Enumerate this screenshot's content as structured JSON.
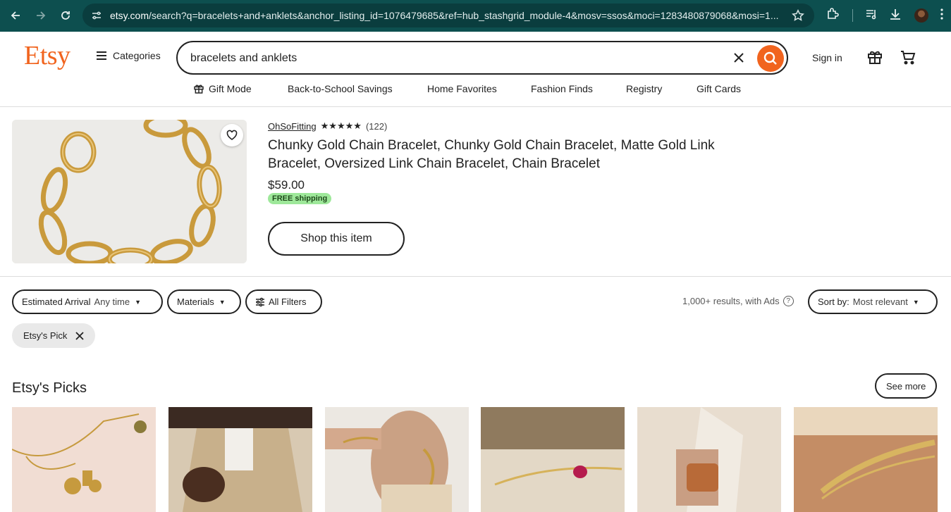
{
  "browser": {
    "url_host": "etsy.com",
    "url_rest": "/search?q=bracelets+and+anklets&anchor_listing_id=1076479685&ref=hub_stashgrid_module-4&mosv=ssos&moci=1283480879068&mosi=1..."
  },
  "header": {
    "logo": "Etsy",
    "categories_label": "Categories",
    "search_value": "bracelets and anklets",
    "signin_label": "Sign in",
    "subnav": [
      "Gift Mode",
      "Back-to-School Savings",
      "Home Favorites",
      "Fashion Finds",
      "Registry",
      "Gift Cards"
    ]
  },
  "ad": {
    "shop_name": "OhSoFitting",
    "stars": "★★★★★",
    "review_count": "(122)",
    "title": "Chunky Gold Chain Bracelet, Chunky Gold Chain Bracelet, Matte Gold Link Bracelet, Oversized Link Chain Bracelet, Chain Bracelet",
    "price": "$59.00",
    "shipping_badge": "FREE shipping",
    "cta": "Shop this item"
  },
  "filters": {
    "arrival_label": "Estimated Arrival",
    "arrival_value": "Any time",
    "materials_label": "Materials",
    "all_filters_label": "All Filters",
    "results_text": "1,000+ results, with Ads",
    "sort_label": "Sort by:",
    "sort_value": "Most relevant",
    "active_chip": "Etsy's Pick"
  },
  "picks": {
    "title": "Etsy's Picks",
    "see_more": "See more"
  },
  "colors": {
    "brand": "#f1641e",
    "chrome": "#0d4f4f",
    "free_shipping": "#9ee89a"
  }
}
